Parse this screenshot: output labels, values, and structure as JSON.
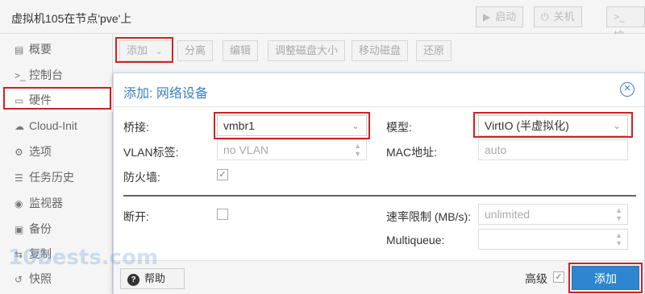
{
  "header": {
    "title": "虚拟机105在节点'pve'上",
    "start_label": "启动",
    "shutdown_label": "关机",
    "console_label": "控"
  },
  "sidebar": {
    "items": [
      {
        "label": "概要",
        "icon": "book-icon"
      },
      {
        "label": "控制台",
        "icon": "terminal-icon"
      },
      {
        "label": "硬件",
        "icon": "monitor-icon"
      },
      {
        "label": "Cloud-Init",
        "icon": "cloud-icon"
      },
      {
        "label": "选项",
        "icon": "gear-icon"
      },
      {
        "label": "任务历史",
        "icon": "list-icon"
      },
      {
        "label": "监视器",
        "icon": "eye-icon"
      },
      {
        "label": "备份",
        "icon": "floppy-icon"
      },
      {
        "label": "复制",
        "icon": "retweet-icon"
      },
      {
        "label": "快照",
        "icon": "history-icon"
      }
    ]
  },
  "toolbar": {
    "add_label": "添加",
    "detach_label": "分离",
    "edit_label": "编辑",
    "resize_label": "调整磁盘大小",
    "move_label": "移动磁盘",
    "revert_label": "还原"
  },
  "dialog": {
    "title": "添加: 网络设备",
    "bridge_label": "桥接:",
    "bridge_value": "vmbr1",
    "model_label": "模型:",
    "model_value": "VirtIO (半虚拟化)",
    "vlan_label": "VLAN标签:",
    "vlan_placeholder": "no VLAN",
    "mac_label": "MAC地址:",
    "mac_placeholder": "auto",
    "firewall_label": "防火墙:",
    "firewall_checked": true,
    "disconnect_label": "断开:",
    "disconnect_checked": false,
    "rate_label": "速率限制 (MB/s):",
    "rate_placeholder": "unlimited",
    "multiqueue_label": "Multiqueue:",
    "multiqueue_value": ""
  },
  "footer": {
    "help_label": "帮助",
    "advanced_label": "高级",
    "advanced_checked": true,
    "submit_label": "添加"
  },
  "watermark": "10bests.com",
  "colors": {
    "accent": "#3a7fc0",
    "primary_button": "#2e85d0",
    "highlight": "#d42020"
  }
}
